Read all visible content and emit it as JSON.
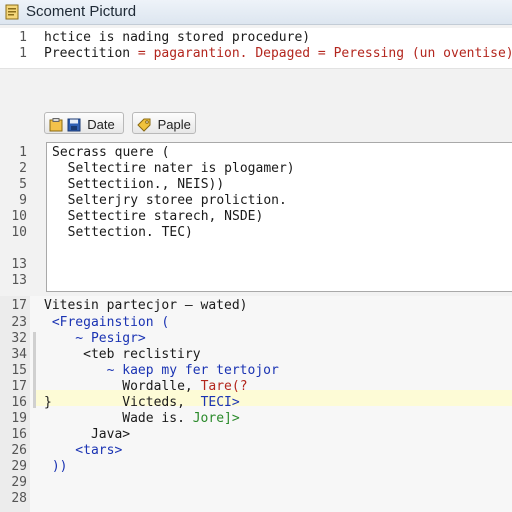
{
  "window": {
    "title": "Scoment Picturd"
  },
  "top_editor": {
    "lines": [
      {
        "num": "1",
        "text": "hctice is nading stored procedure)",
        "color": "default"
      },
      {
        "num": "1",
        "text": "Preectition = pagarantion. Depaged = Peressing (un oventise)",
        "color": "mixed"
      }
    ],
    "line2_parts": [
      "Preectition ",
      "= pagarantion. Depaged = ",
      "Peressing (un oventise)"
    ]
  },
  "toolbar": {
    "buttons": [
      {
        "label": "Date",
        "icon": "save-icon"
      },
      {
        "label": "Paple",
        "icon": "tag-icon"
      }
    ]
  },
  "query_editor": {
    "lines": [
      {
        "num": "1",
        "text": "Secrass quere ("
      },
      {
        "num": "2",
        "text": "  Seltectire nater is plogamer)"
      },
      {
        "num": "5",
        "text": "  Settectiion., NEIS))"
      },
      {
        "num": "9",
        "text": "  Selterjry storee proliction."
      },
      {
        "num": "10",
        "text": "  Settectire starech, NSDE)"
      },
      {
        "num": "10",
        "text": "  Settection. TEC)"
      },
      {
        "num": "13",
        "text": ""
      },
      {
        "num": "13",
        "text": ""
      }
    ]
  },
  "lower_editor": {
    "lines": [
      {
        "num": "17",
        "text": "Vitesin partecjor — wated)",
        "color": "default"
      },
      {
        "num": "23",
        "text": " <Fregainstion (",
        "color": "blue"
      },
      {
        "num": "32",
        "text": "    ~ Pesigr>",
        "color": "blue"
      },
      {
        "num": "34",
        "text": "     <teb reclistiry",
        "color": "default"
      },
      {
        "num": "15",
        "text": "        ~ kaep my fer tertojor",
        "color": "blue"
      },
      {
        "num": "17",
        "text": "          Wordalle, Tare(?",
        "color": "mixed"
      },
      {
        "num": "16",
        "text": "          Victeds,  TECI>",
        "color": "mixed"
      },
      {
        "num": "19",
        "text": "          Wade is. Jore]>",
        "color": "mixed"
      },
      {
        "num": "16",
        "text": "      Java>",
        "color": "default"
      },
      {
        "num": "26",
        "text": "    <tars>",
        "color": "blue"
      },
      {
        "num": "29",
        "text": " ))",
        "color": "blue"
      },
      {
        "num": "29",
        "text": "",
        "color": "default"
      },
      {
        "num": "28",
        "text": "",
        "color": "default"
      }
    ],
    "mixed_parts": {
      "l5": [
        "Wordalle, ",
        "Tare(?"
      ],
      "l6": [
        "Victeds,  ",
        "TECI>"
      ],
      "l7": [
        "Wade is. ",
        "Jore]>"
      ]
    },
    "fold_marker": "}"
  },
  "colors": {
    "red": "#b3261e",
    "blue": "#1a33b3",
    "green": "#2a8a2a",
    "highlight": "#fdfbd6"
  }
}
